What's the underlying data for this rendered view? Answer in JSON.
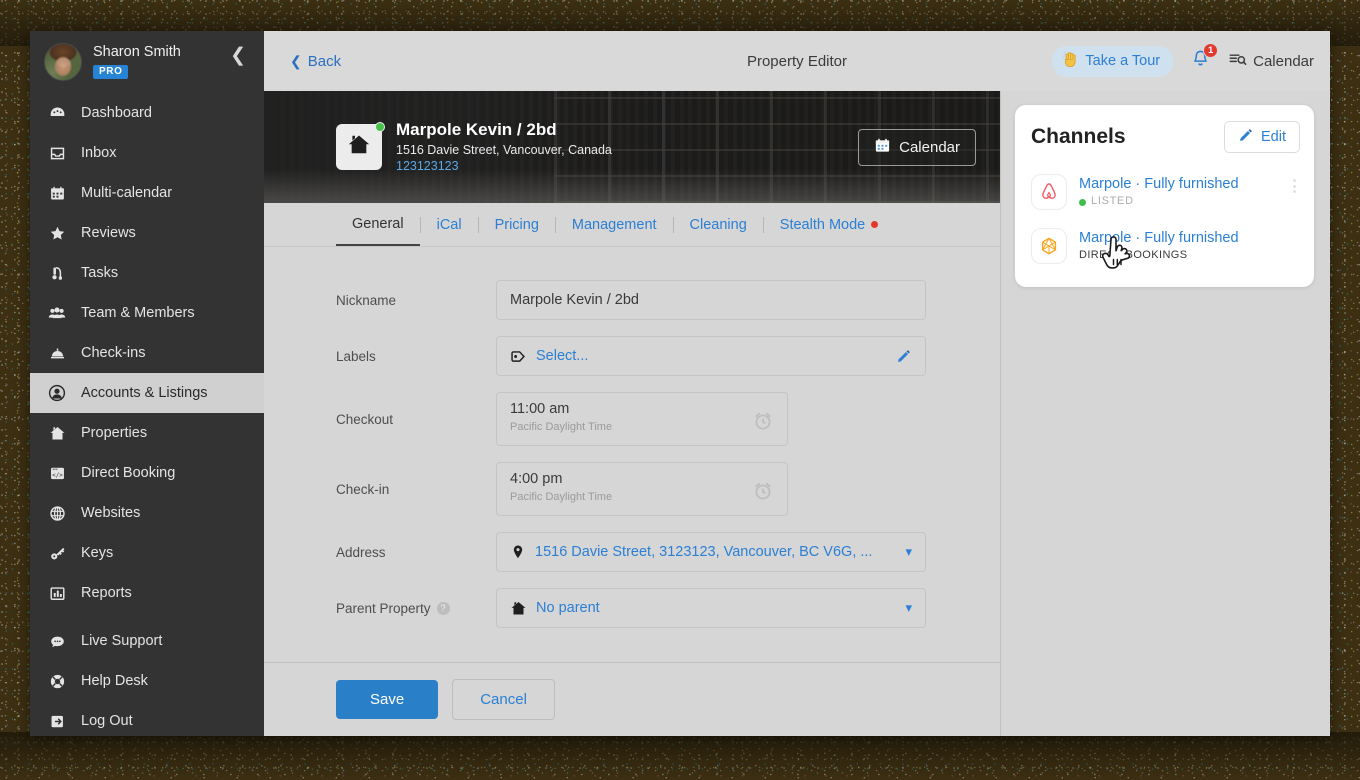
{
  "sidebar": {
    "user": {
      "name": "Sharon Smith",
      "badge": "PRO"
    },
    "collapse_icon": "chevron-left-icon",
    "items": [
      {
        "label": "Dashboard",
        "icon": "dashboard-icon",
        "active": false
      },
      {
        "label": "Inbox",
        "icon": "inbox-icon",
        "active": false
      },
      {
        "label": "Multi-calendar",
        "icon": "calendar-icon",
        "active": false
      },
      {
        "label": "Reviews",
        "icon": "star-icon",
        "active": false
      },
      {
        "label": "Tasks",
        "icon": "vacuum-icon",
        "active": false
      },
      {
        "label": "Team & Members",
        "icon": "people-icon",
        "active": false
      },
      {
        "label": "Check-ins",
        "icon": "bell-desk-icon",
        "active": false
      },
      {
        "label": "Accounts & Listings",
        "icon": "user-circle-icon",
        "active": true
      },
      {
        "label": "Properties",
        "icon": "home-icon",
        "active": false
      },
      {
        "label": "Direct Booking",
        "icon": "code-window-icon",
        "active": false
      },
      {
        "label": "Websites",
        "icon": "globe-icon",
        "active": false
      },
      {
        "label": "Keys",
        "icon": "key-icon",
        "active": false
      },
      {
        "label": "Reports",
        "icon": "bar-chart-icon",
        "active": false
      },
      {
        "label": "Live Support",
        "icon": "chat-bubble-icon",
        "active": false
      },
      {
        "label": "Help Desk",
        "icon": "lifebuoy-icon",
        "active": false
      },
      {
        "label": "Log Out",
        "icon": "logout-icon",
        "active": false
      }
    ]
  },
  "topbar": {
    "back_label": "Back",
    "title": "Property Editor",
    "tour_label": "Take a Tour",
    "tour_icon": "waving-hand-icon",
    "notification_icon": "bell-icon",
    "notification_count": "1",
    "calendar_label": "Calendar",
    "calendar_icon": "calendar-list-icon"
  },
  "hero": {
    "property_name": "Marpole Kevin / 2bd",
    "address": "1516 Davie Street, Vancouver, Canada",
    "property_id": "123123123",
    "thumb_icon": "home-icon",
    "calendar_button": "Calendar",
    "calendar_button_icon": "calendar-icon"
  },
  "tabs": [
    {
      "label": "General",
      "active": true,
      "dot": false
    },
    {
      "label": "iCal",
      "active": false,
      "dot": false
    },
    {
      "label": "Pricing",
      "active": false,
      "dot": false
    },
    {
      "label": "Management",
      "active": false,
      "dot": false
    },
    {
      "label": "Cleaning",
      "active": false,
      "dot": false
    },
    {
      "label": "Stealth Mode",
      "active": false,
      "dot": true
    }
  ],
  "form": {
    "nickname": {
      "label": "Nickname",
      "value": "Marpole Kevin / 2bd"
    },
    "labels": {
      "label": "Labels",
      "value": "Select...",
      "icon": "tag-icon",
      "edit_icon": "pencil-icon"
    },
    "checkout": {
      "label": "Checkout",
      "value": "11:00 am",
      "timezone": "Pacific Daylight Time",
      "icon": "alarm-clock-icon"
    },
    "checkin": {
      "label": "Check-in",
      "value": "4:00 pm",
      "timezone": "Pacific Daylight Time",
      "icon": "alarm-clock-icon"
    },
    "address": {
      "label": "Address",
      "value": "1516 Davie Street, 3123123, Vancouver, BC V6G, ...",
      "icon": "map-pin-icon",
      "chevron": "chevron-down-icon"
    },
    "parent_property": {
      "label": "Parent Property",
      "value": "No parent",
      "icon": "home-icon",
      "help": "?",
      "chevron": "chevron-down-icon"
    }
  },
  "footer": {
    "save_label": "Save",
    "cancel_label": "Cancel"
  },
  "channels": {
    "title": "Channels",
    "edit_label": "Edit",
    "edit_icon": "pencil-icon",
    "menu_icon": "kebab-menu-icon",
    "items": [
      {
        "name": "Marpole · Fully furnished",
        "status": "LISTED",
        "has_status_dot": true,
        "icon": "airbnb-icon"
      },
      {
        "name": "Marpole · Fully furnished",
        "status": "DIRECT BOOKINGS",
        "has_status_dot": false,
        "icon": "direct-booking-icon"
      }
    ]
  },
  "colors": {
    "accent_blue": "#2b7fd4",
    "primary_button": "#2a7fc9",
    "sidebar_bg": "#333333",
    "listed_green": "#3fbf4a",
    "alert_red": "#e0392c",
    "airbnb_red": "#ef5a62",
    "direct_orange": "#f5a623"
  },
  "cursor": {
    "icon": "pointing-hand-cursor"
  }
}
